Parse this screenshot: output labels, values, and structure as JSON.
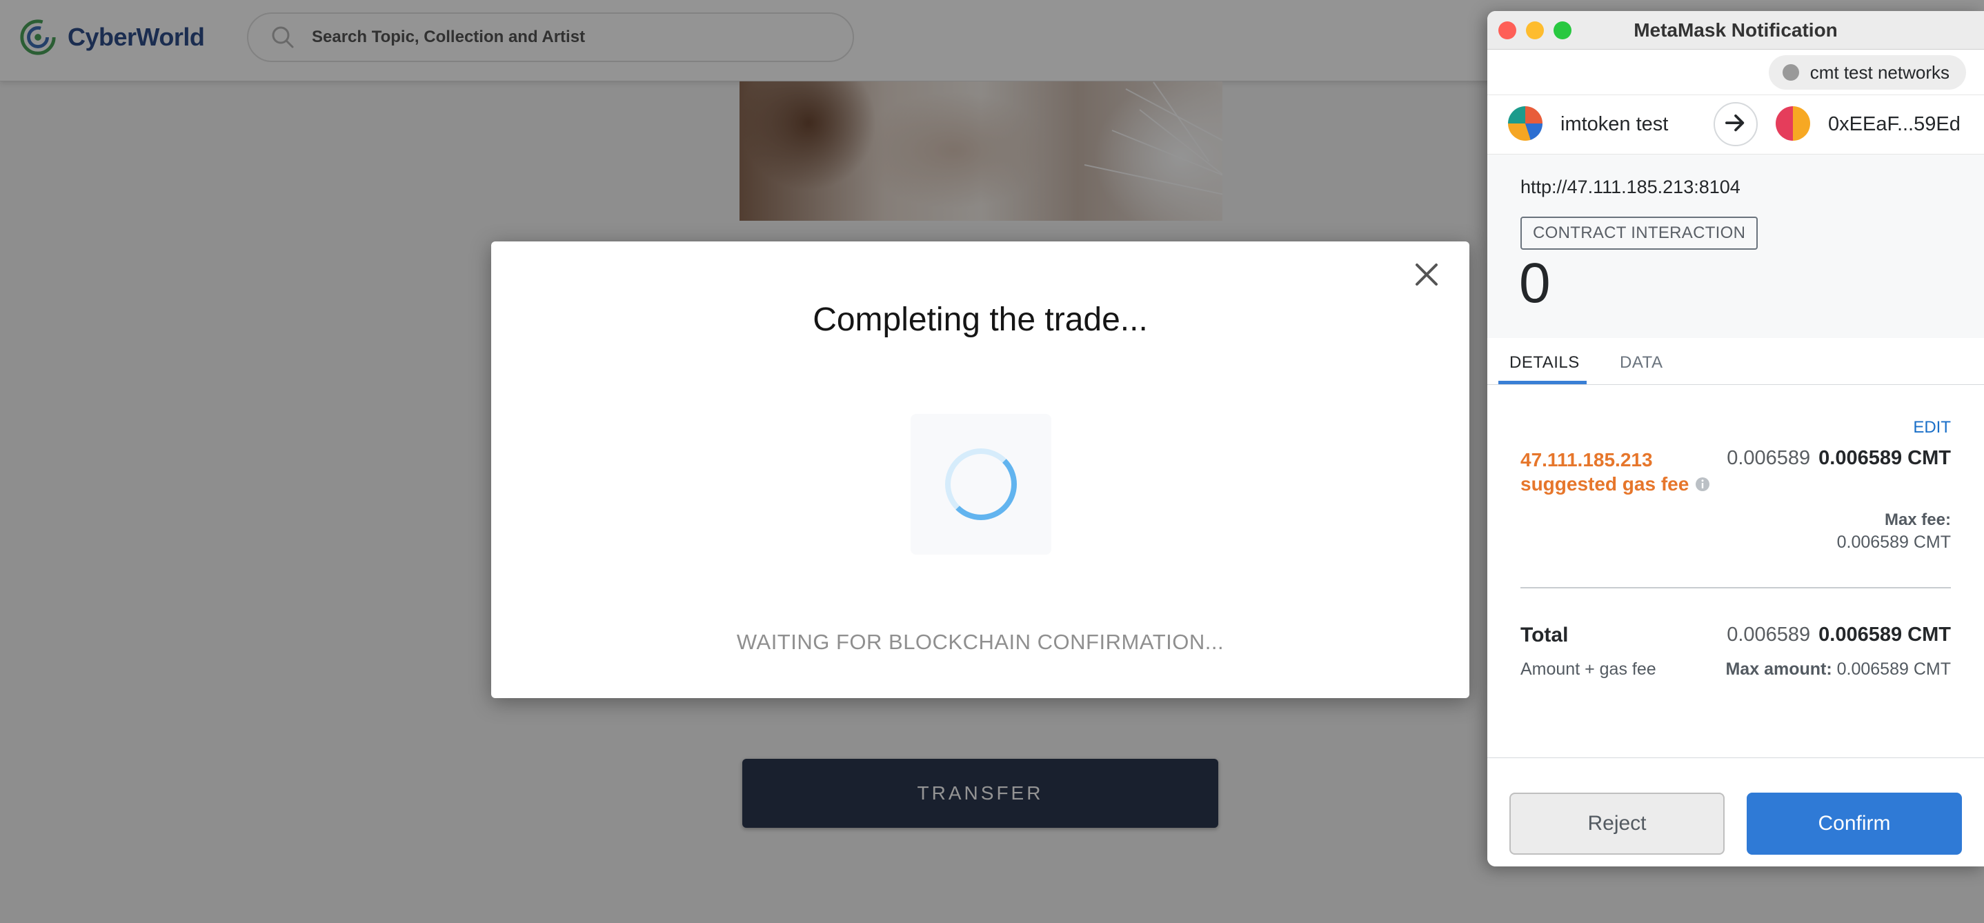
{
  "app": {
    "brand": "CyberWorld",
    "search": {
      "placeholder": "Search Topic, Collection and Artist"
    },
    "transfer_label": "TRANSFER"
  },
  "modal": {
    "title": "Completing the trade...",
    "status": "WAITING FOR BLOCKCHAIN CONFIRMATION..."
  },
  "metamask": {
    "window_title": "MetaMask Notification",
    "network": "cmt test networks",
    "from_account": "imtoken test",
    "to_account": "0xEEaF...59Ed",
    "origin": "http://47.111.185.213:8104",
    "interaction_badge": "CONTRACT INTERACTION",
    "amount": "0",
    "tabs": {
      "details": "DETAILS",
      "data": "DATA"
    },
    "edit_label": "EDIT",
    "gas": {
      "origin": "47.111.185.213",
      "label": "suggested gas fee",
      "secondary": "0.006589",
      "primary": "0.006589 CMT",
      "max_fee_label": "Max fee:",
      "max_fee_value": "0.006589 CMT"
    },
    "total": {
      "label": "Total",
      "secondary": "0.006589",
      "primary": "0.006589 CMT",
      "sub_label": "Amount + gas fee",
      "max_amount_label": "Max amount:",
      "max_amount_value": "0.006589 CMT"
    },
    "buttons": {
      "reject": "Reject",
      "confirm": "Confirm"
    }
  },
  "colors": {
    "metamask_accent": "#2f7ad6",
    "gas_fee_orange": "#e6762b",
    "transfer_button": "#2c3850",
    "spinner": "#62b4ef"
  },
  "icons": [
    "cyberworld-logo-icon",
    "search-icon",
    "close-icon",
    "spinner-icon",
    "network-icon",
    "arrow-right-icon",
    "info-icon"
  ]
}
